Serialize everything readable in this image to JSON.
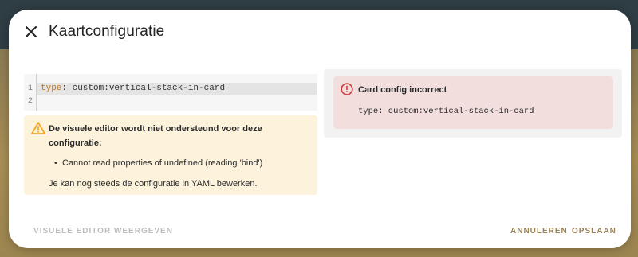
{
  "dialog": {
    "title": "Kaartconfiguratie"
  },
  "editor": {
    "line_numbers": [
      "1",
      "2"
    ],
    "line1_key": "type",
    "line1_rest": ": custom:vertical-stack-in-card"
  },
  "warning": {
    "heading": "De visuele editor wordt niet ondersteund voor deze configuratie:",
    "items": [
      "Cannot read properties of undefined (reading 'bind')"
    ],
    "footer": "Je kan nog steeds de configuratie in YAML bewerken."
  },
  "preview": {
    "error_title": "Card config incorrect",
    "error_code": "type: custom:vertical-stack-in-card"
  },
  "actions": {
    "visual_editor": "VISUELE EDITOR WEERGEVEN",
    "cancel": "ANNULEREN",
    "save": "OPSLAAN"
  },
  "colors": {
    "accent": "#9a8257",
    "warning_bg": "#fdf3dd",
    "warning_icon": "#f0a823",
    "error_bg": "#f3dede",
    "error_icon": "#d33a3a"
  },
  "icons": {
    "close": "close-icon",
    "warning": "warning-icon",
    "error": "error-icon"
  }
}
